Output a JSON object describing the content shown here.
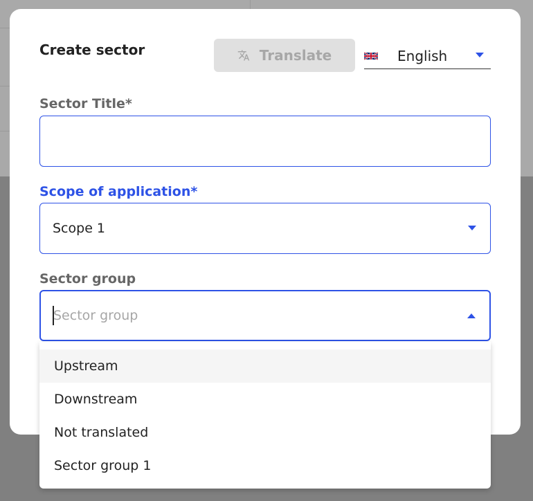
{
  "dialog": {
    "title": "Create sector",
    "translate_label": "Translate",
    "language": "English"
  },
  "form": {
    "sector_title": {
      "label": "Sector Title*",
      "value": ""
    },
    "scope": {
      "label": "Scope of application*",
      "value": "Scope 1"
    },
    "sector_group": {
      "label": "Sector group",
      "placeholder": "Sector group"
    }
  },
  "menu": {
    "items": [
      "Upstream",
      "Downstream",
      "Not translated",
      "Sector group 1"
    ]
  },
  "colors": {
    "accent": "#2d52e6"
  },
  "icons": {
    "translate": "translate-icon",
    "flag": "uk-flag-icon",
    "caret": "caret-icon"
  }
}
